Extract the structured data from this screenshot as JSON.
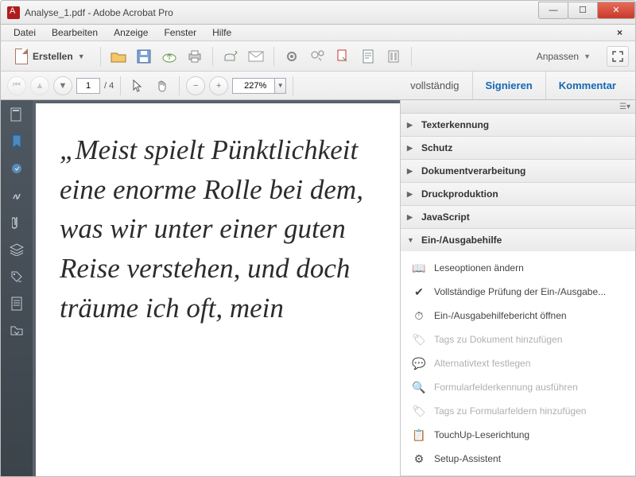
{
  "window": {
    "title": "Analyse_1.pdf - Adobe Acrobat Pro"
  },
  "menu": {
    "items": [
      "Datei",
      "Bearbeiten",
      "Anzeige",
      "Fenster",
      "Hilfe"
    ]
  },
  "toolbar": {
    "create_label": "Erstellen",
    "customize_label": "Anpassen"
  },
  "nav": {
    "page_current": "1",
    "page_total": "/ 4",
    "zoom": "227%",
    "links": {
      "vollstandig": "vollständig",
      "signieren": "Signieren",
      "kommentar": "Kommentar"
    }
  },
  "document": {
    "body_text": "„Meist spielt Pünktlichkeit eine enorme Rolle bei dem, was wir unter einer guten Reise verstehen, und doch träume ich oft, mein"
  },
  "right_panel": {
    "sections": [
      {
        "label": "Texterkennung",
        "expanded": false
      },
      {
        "label": "Schutz",
        "expanded": false
      },
      {
        "label": "Dokumentverarbeitung",
        "expanded": false
      },
      {
        "label": "Druckproduktion",
        "expanded": false
      },
      {
        "label": "JavaScript",
        "expanded": false
      },
      {
        "label": "Ein-/Ausgabehilfe",
        "expanded": true
      }
    ],
    "tools": [
      {
        "label": "Leseoptionen ändern",
        "enabled": true,
        "icon": "📖"
      },
      {
        "label": "Vollständige Prüfung der Ein-/Ausgabe...",
        "enabled": true,
        "icon": "✔"
      },
      {
        "label": "Ein-/Ausgabehilfebericht öffnen",
        "enabled": true,
        "icon": "⏱"
      },
      {
        "label": "Tags zu Dokument hinzufügen",
        "enabled": false,
        "icon": "🏷"
      },
      {
        "label": "Alternativtext festlegen",
        "enabled": false,
        "icon": "💬"
      },
      {
        "label": "Formularfelderkennung ausführen",
        "enabled": false,
        "icon": "🔍"
      },
      {
        "label": "Tags zu Formularfeldern hinzufügen",
        "enabled": false,
        "icon": "🏷"
      },
      {
        "label": "TouchUp-Leserichtung",
        "enabled": true,
        "icon": "📋"
      },
      {
        "label": "Setup-Assistent",
        "enabled": true,
        "icon": "⚙"
      }
    ]
  }
}
